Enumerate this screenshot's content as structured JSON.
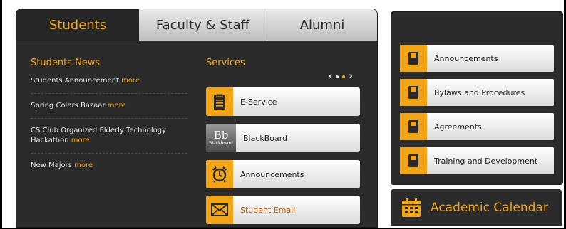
{
  "tabs": [
    "Students",
    "Faculty & Staff",
    "Alumni"
  ],
  "news": {
    "title": "Students News",
    "more_label": "more",
    "items": [
      "Students Announcement",
      "Spring Colors Bazaar",
      "CS Club Organized Elderly Technology Hackathon",
      "New Majors"
    ]
  },
  "services": {
    "title": "Services",
    "pager": {
      "prev": "‹",
      "next": "›",
      "active_dot": 2
    },
    "items": [
      {
        "label": "E-Service",
        "icon": "clipboard-icon"
      },
      {
        "label": "BlackBoard",
        "icon": "blackboard-logo",
        "logo_big": "Bb",
        "logo_small": "Blackboard"
      },
      {
        "label": "Announcements",
        "icon": "alarm-clock-icon"
      },
      {
        "label": "Student Email",
        "icon": "envelope-icon"
      }
    ]
  },
  "quick_links": [
    {
      "label": "Announcements",
      "icon": "book-icon"
    },
    {
      "label": "Bylaws and Procedures",
      "icon": "book-icon"
    },
    {
      "label": "Agreements",
      "icon": "book-icon"
    },
    {
      "label": "Training and Development",
      "icon": "book-icon"
    }
  ],
  "calendar": {
    "label": "Academic Calendar",
    "icon": "calendar-icon"
  },
  "colors": {
    "accent": "#f2a417",
    "panel": "#2b2b2b",
    "highlight_text": "#c85a00"
  }
}
